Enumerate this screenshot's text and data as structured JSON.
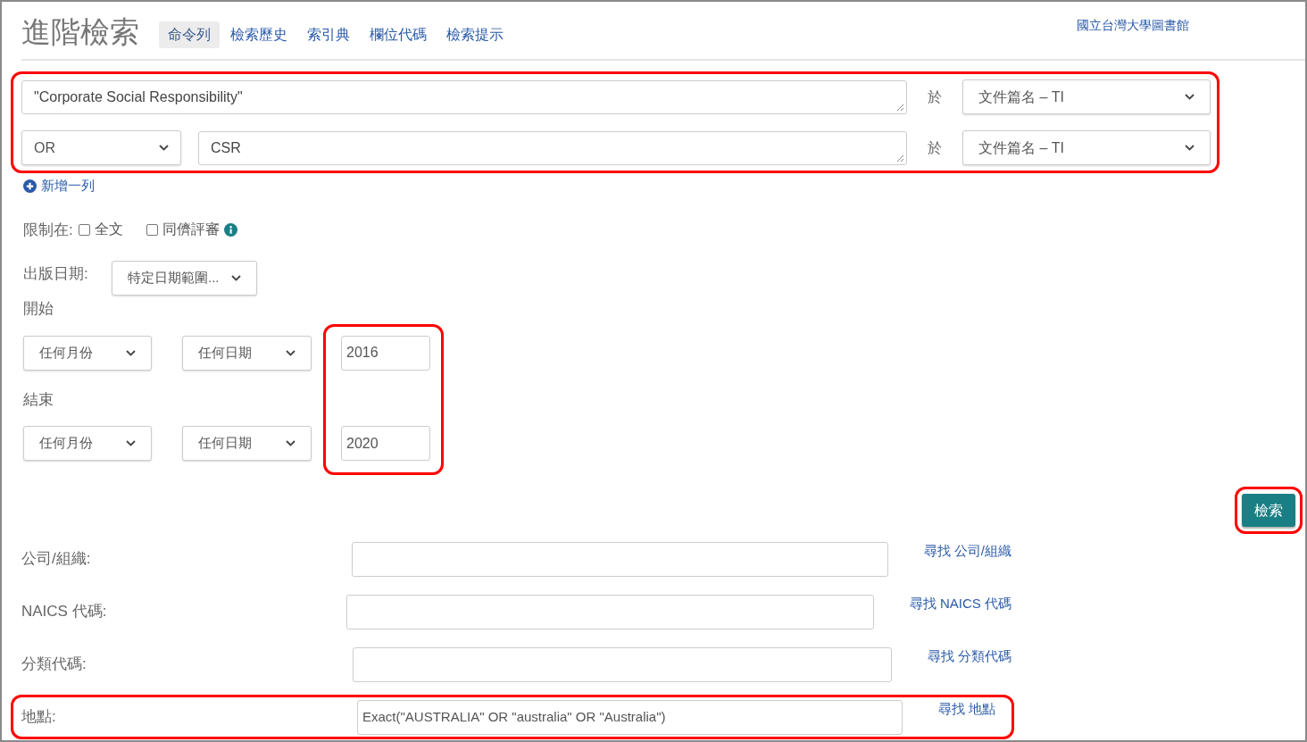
{
  "header": {
    "title": "進階檢索",
    "tabs": [
      {
        "label": "命令列",
        "selected": true
      },
      {
        "label": "檢索歷史",
        "selected": false
      },
      {
        "label": "索引典",
        "selected": false
      },
      {
        "label": "欄位代碼",
        "selected": false
      },
      {
        "label": "檢索提示",
        "selected": false
      }
    ],
    "library_link": "國立台灣大學圖書館"
  },
  "query": {
    "highlighted": true,
    "rows": [
      {
        "kind": "first",
        "value": "\"Corporate Social Responsibility\"",
        "in_label": "於",
        "field": "文件篇名 – TI"
      },
      {
        "kind": "joined",
        "operator": "OR",
        "value": "CSR",
        "in_label": "於",
        "field": "文件篇名 – TI"
      }
    ]
  },
  "add_row": "新增一列",
  "limit": {
    "label": "限制在:",
    "options": [
      {
        "label": "全文",
        "checked": false,
        "info": false
      },
      {
        "label": "同儕評審",
        "checked": false,
        "info": true
      }
    ]
  },
  "date": {
    "label": "出版日期:",
    "mode": "特定日期範圍...",
    "years_highlighted": true,
    "start": {
      "label": "開始",
      "month": "任何月份",
      "day": "任何日期",
      "year": "2016"
    },
    "end": {
      "label": "結束",
      "month": "任何月份",
      "day": "任何日期",
      "year": "2020"
    }
  },
  "search_button": {
    "label": "檢索",
    "highlighted": true
  },
  "fields": [
    {
      "label": "公司/組織:",
      "link": "尋找 公司/組織",
      "highlighted": false
    },
    {
      "label": "NAICS 代碼:",
      "link": "尋找 NAICS 代碼",
      "highlighted": false
    },
    {
      "label": "分類代碼:",
      "link": "尋找 分類代碼",
      "highlighted": false
    },
    {
      "label": "地點:",
      "value": "Exact(\"AUSTRALIA\" OR \"australia\" OR \"Australia\")",
      "link": "尋找 地點",
      "highlighted": true
    }
  ]
}
